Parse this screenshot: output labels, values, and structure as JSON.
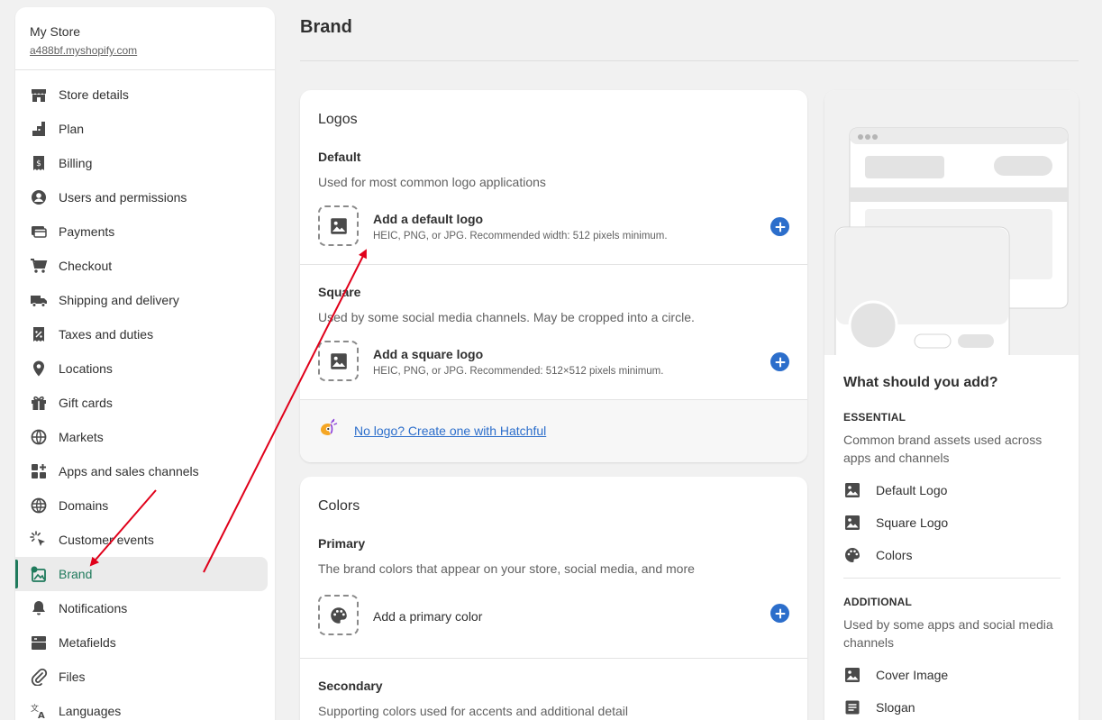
{
  "store": {
    "name": "My Store",
    "url": "a488bf.myshopify.com"
  },
  "nav": [
    {
      "label": "Store details",
      "icon": "store-icon",
      "slug": "store-details"
    },
    {
      "label": "Plan",
      "icon": "plan-icon",
      "slug": "plan"
    },
    {
      "label": "Billing",
      "icon": "billing-icon",
      "slug": "billing"
    },
    {
      "label": "Users and permissions",
      "icon": "user-icon",
      "slug": "users"
    },
    {
      "label": "Payments",
      "icon": "payments-icon",
      "slug": "payments"
    },
    {
      "label": "Checkout",
      "icon": "cart-icon",
      "slug": "checkout"
    },
    {
      "label": "Shipping and delivery",
      "icon": "truck-icon",
      "slug": "shipping"
    },
    {
      "label": "Taxes and duties",
      "icon": "tax-icon",
      "slug": "taxes"
    },
    {
      "label": "Locations",
      "icon": "location-pin-icon",
      "slug": "locations"
    },
    {
      "label": "Gift cards",
      "icon": "gift-icon",
      "slug": "gift-cards"
    },
    {
      "label": "Markets",
      "icon": "globe-icon",
      "slug": "markets"
    },
    {
      "label": "Apps and sales channels",
      "icon": "apps-icon",
      "slug": "apps"
    },
    {
      "label": "Domains",
      "icon": "domain-globe-icon",
      "slug": "domains"
    },
    {
      "label": "Customer events",
      "icon": "cursor-click-icon",
      "slug": "customer-events"
    },
    {
      "label": "Brand",
      "icon": "brand-icon",
      "slug": "brand",
      "active": true
    },
    {
      "label": "Notifications",
      "icon": "bell-icon",
      "slug": "notifications"
    },
    {
      "label": "Metafields",
      "icon": "metafields-icon",
      "slug": "metafields"
    },
    {
      "label": "Files",
      "icon": "paperclip-icon",
      "slug": "files"
    },
    {
      "label": "Languages",
      "icon": "translate-icon",
      "slug": "languages"
    }
  ],
  "page": {
    "title": "Brand"
  },
  "logos": {
    "title": "Logos",
    "default": {
      "title": "Default",
      "desc": "Used for most common logo applications",
      "action": "Add a default logo",
      "hint": "HEIC, PNG, or JPG. Recommended width: 512 pixels minimum."
    },
    "square": {
      "title": "Square",
      "desc": "Used by some social media channels. May be cropped into a circle.",
      "action": "Add a square logo",
      "hint": "HEIC, PNG, or JPG. Recommended: 512×512 pixels minimum."
    },
    "hatchful_link": "No logo? Create one with Hatchful"
  },
  "colors": {
    "title": "Colors",
    "primary": {
      "title": "Primary",
      "desc": "The brand colors that appear on your store, social media, and more",
      "action": "Add a primary color"
    },
    "secondary": {
      "title": "Secondary",
      "desc": "Supporting colors used for accents and additional detail"
    }
  },
  "guide": {
    "title": "What should you add?",
    "essential_label": "ESSENTIAL",
    "essential_desc": "Common brand assets used across apps and channels",
    "essential_items": [
      "Default Logo",
      "Square Logo",
      "Colors"
    ],
    "additional_label": "ADDITIONAL",
    "additional_desc": "Used by some apps and social media channels",
    "additional_items": [
      "Cover Image",
      "Slogan"
    ]
  },
  "colors_theme": {
    "accent": "#2c6ecb",
    "active": "#1f7a5c",
    "annotation": "#e0001a"
  }
}
